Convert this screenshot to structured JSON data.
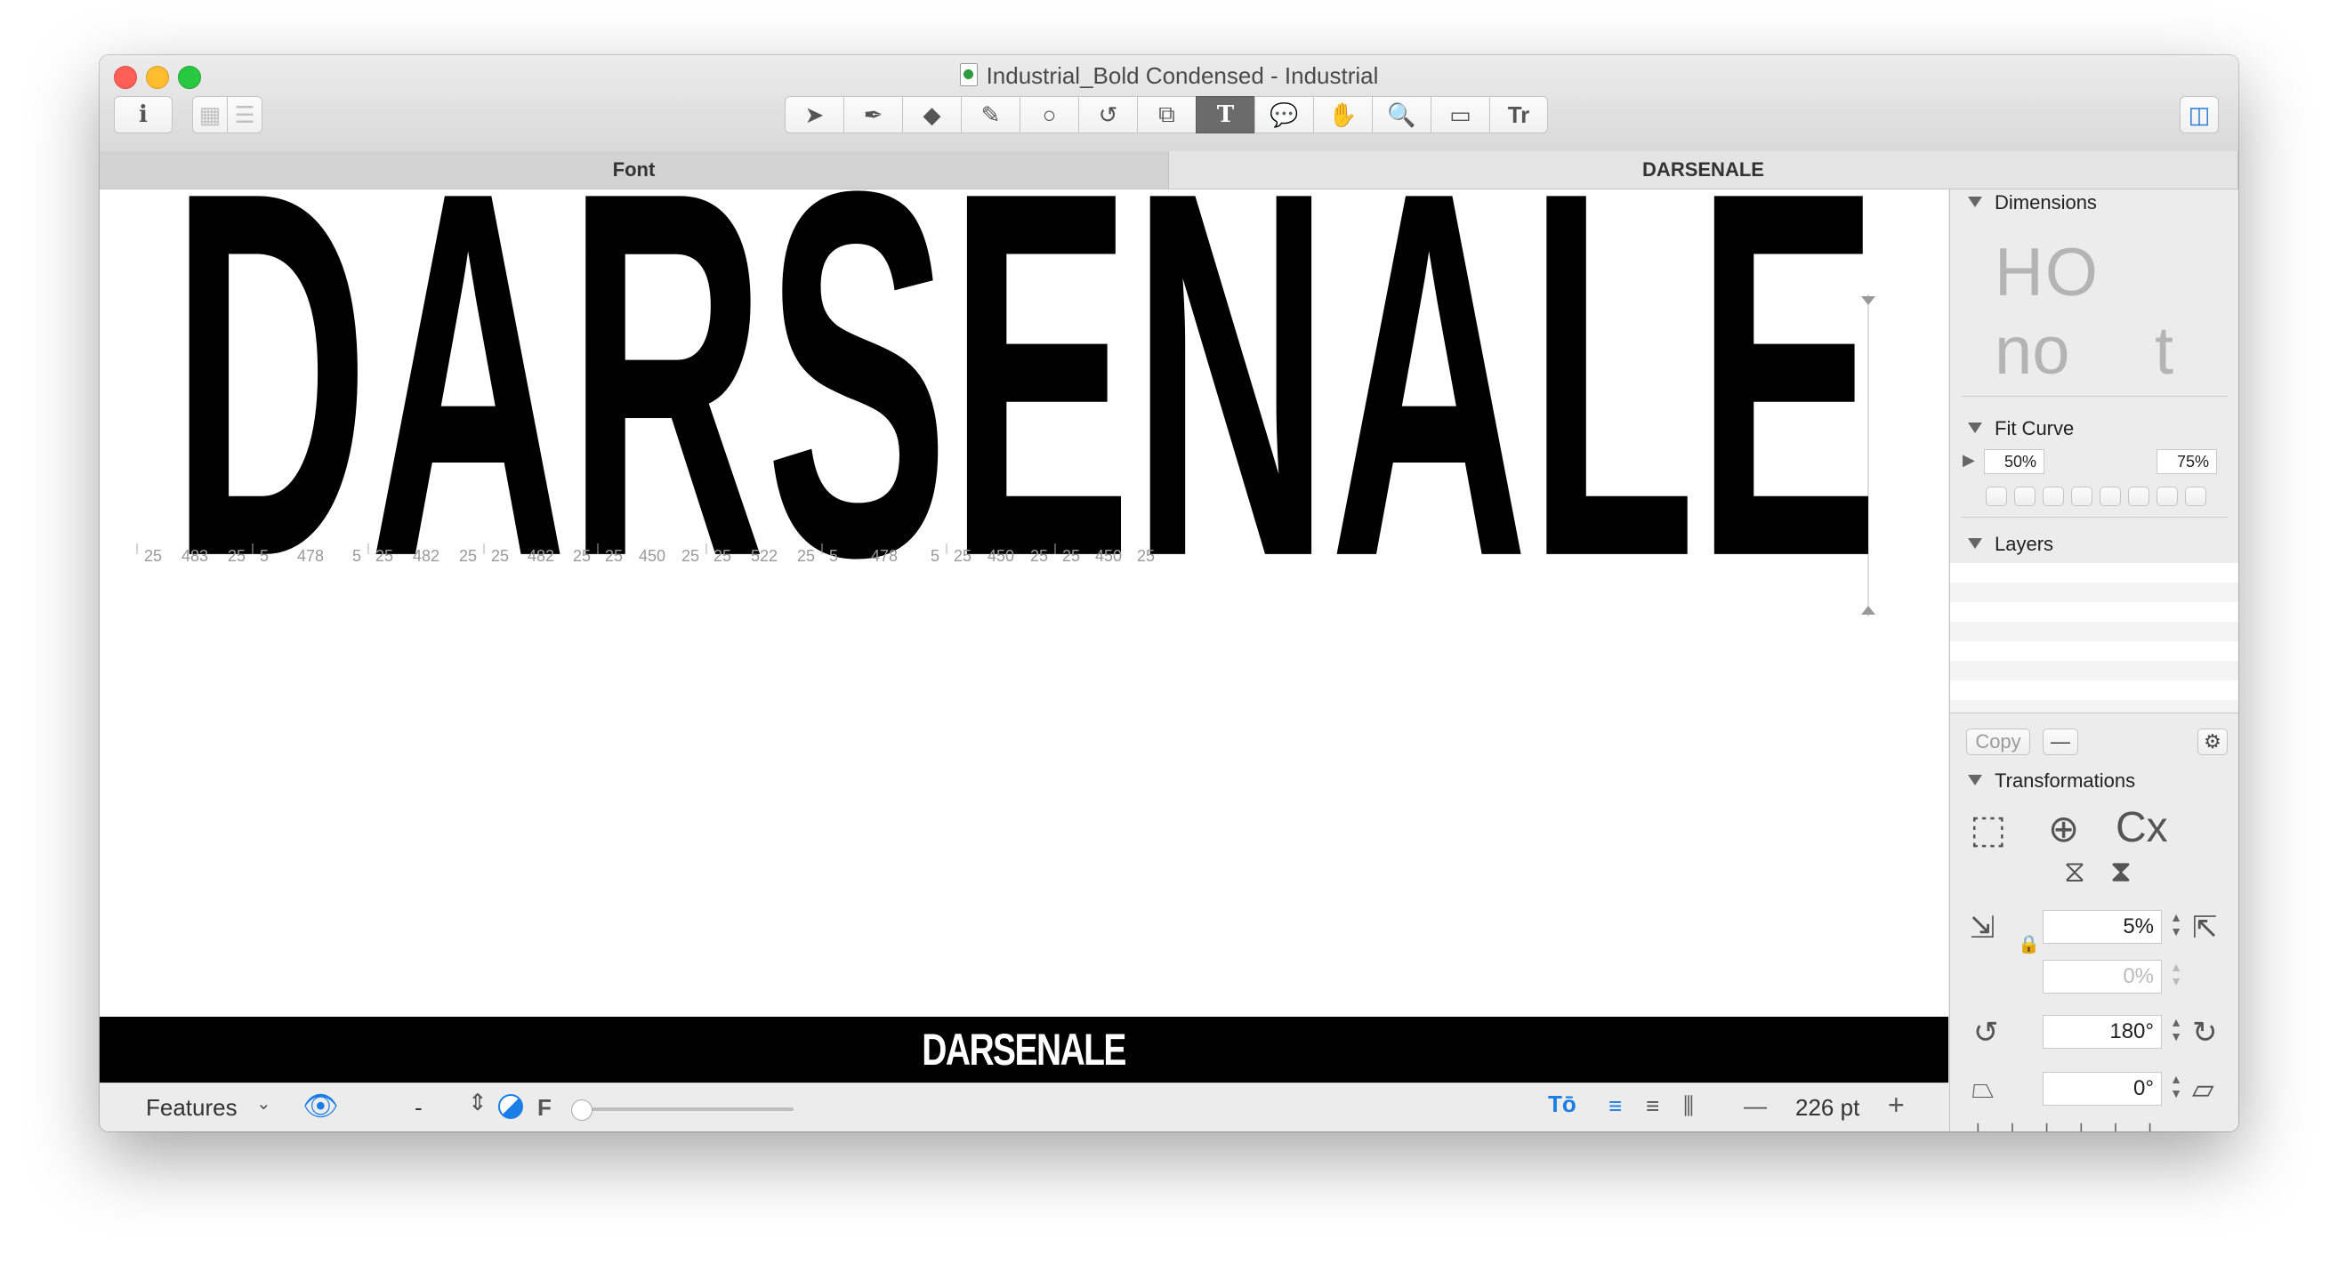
{
  "window": {
    "title": "Industrial_Bold Condensed - Industrial",
    "traffic_colors": [
      "#ff5f57",
      "#febc2e",
      "#28c840"
    ]
  },
  "toolbar": {
    "left_buttons": [
      "info-icon",
      "grid-view-icon",
      "list-view-icon"
    ],
    "tools": [
      "select-tool-icon",
      "pen-tool-icon",
      "eraser-tool-icon",
      "pencil-tool-icon",
      "shape-tool-icon",
      "rotate-tool-icon",
      "scale-tool-icon",
      "text-tool-icon",
      "annotation-tool-icon",
      "hand-tool-icon",
      "zoom-tool-icon",
      "measure-tool-icon",
      "metrics-tool-icon"
    ],
    "selected_tool": "text-tool-icon",
    "text_tool_glyph": "T"
  },
  "tabs": [
    {
      "label": "Font",
      "active": true
    },
    {
      "label": "DARSENALE",
      "active": false
    }
  ],
  "canvas": {
    "text": "DARSENALE",
    "glyph_metrics": [
      {
        "glyph": "D",
        "lsb": "25",
        "width": "483",
        "rsb": "25"
      },
      {
        "glyph": "A",
        "lsb": "5",
        "width": "478",
        "rsb": "5"
      },
      {
        "glyph": "R",
        "lsb": "25",
        "width": "482",
        "rsb": "25"
      },
      {
        "glyph": "S",
        "lsb": "25",
        "width": "482",
        "rsb": "25"
      },
      {
        "glyph": "E",
        "lsb": "25",
        "width": "450",
        "rsb": "25"
      },
      {
        "glyph": "N",
        "lsb": "25",
        "width": "522",
        "rsb": "25"
      },
      {
        "glyph": "A",
        "lsb": "5",
        "width": "478",
        "rsb": "5"
      },
      {
        "glyph": "L",
        "lsb": "25",
        "width": "450",
        "rsb": "25"
      },
      {
        "glyph": "E",
        "lsb": "25",
        "width": "450",
        "rsb": "25"
      }
    ]
  },
  "preview": {
    "text": "DARSENALE"
  },
  "statusbar": {
    "features_label": "Features",
    "separator": "-",
    "f_label": "F",
    "font_size": "226 pt",
    "minus": "—",
    "plus": "+"
  },
  "sidebar": {
    "dimensions_label": "Dimensions",
    "dimension_samples": [
      "HO",
      "no",
      "t"
    ],
    "fit_curve_label": "Fit Curve",
    "fit_curve_low": "50%",
    "fit_curve_high": "75%",
    "layers_label": "Layers",
    "copy_label": "Copy",
    "remove_label": "—",
    "transformations_label": "Transformations",
    "scale_value": "5%",
    "scale_value_2": "0%",
    "rotate_value": "180°",
    "slant_value": "0°",
    "cx_label": "Cx"
  }
}
